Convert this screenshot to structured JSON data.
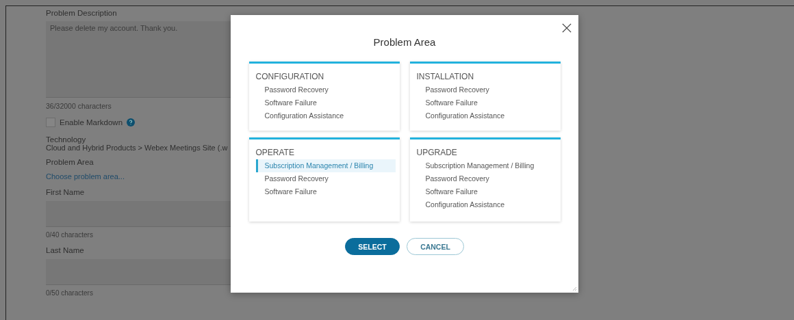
{
  "form": {
    "description": {
      "label": "Problem Description",
      "value": "Please delete my account. Thank you.",
      "count": "36/32000 characters"
    },
    "markdown": {
      "label": "Enable Markdown",
      "checked": false
    },
    "technology": {
      "label": "Technology",
      "value": "Cloud and Hybrid Products > Webex Meetings Site (.w"
    },
    "problem_area": {
      "label": "Problem Area",
      "link": "Choose problem area..."
    },
    "fields": [
      {
        "label": "First Name",
        "count": "0/40 characters"
      },
      {
        "label": "Last Name",
        "count": "0/50 characters"
      }
    ]
  },
  "modal": {
    "title": "Problem Area",
    "categories": [
      {
        "name": "CONFIGURATION",
        "items": [
          {
            "label": "Password Recovery",
            "selected": false
          },
          {
            "label": "Software Failure",
            "selected": false
          },
          {
            "label": "Configuration Assistance",
            "selected": false
          }
        ]
      },
      {
        "name": "INSTALLATION",
        "items": [
          {
            "label": "Password Recovery",
            "selected": false
          },
          {
            "label": "Software Failure",
            "selected": false
          },
          {
            "label": "Configuration Assistance",
            "selected": false
          }
        ]
      },
      {
        "name": "OPERATE",
        "items": [
          {
            "label": "Subscription Management / Billing",
            "selected": true
          },
          {
            "label": "Password Recovery",
            "selected": false
          },
          {
            "label": "Software Failure",
            "selected": false
          }
        ]
      },
      {
        "name": "UPGRADE",
        "items": [
          {
            "label": "Subscription Management / Billing",
            "selected": false
          },
          {
            "label": "Password Recovery",
            "selected": false
          },
          {
            "label": "Software Failure",
            "selected": false
          },
          {
            "label": "Configuration Assistance",
            "selected": false
          }
        ]
      }
    ],
    "buttons": [
      {
        "label": "SELECT",
        "kind": "primary"
      },
      {
        "label": "CANCEL",
        "kind": "secondary"
      }
    ]
  }
}
